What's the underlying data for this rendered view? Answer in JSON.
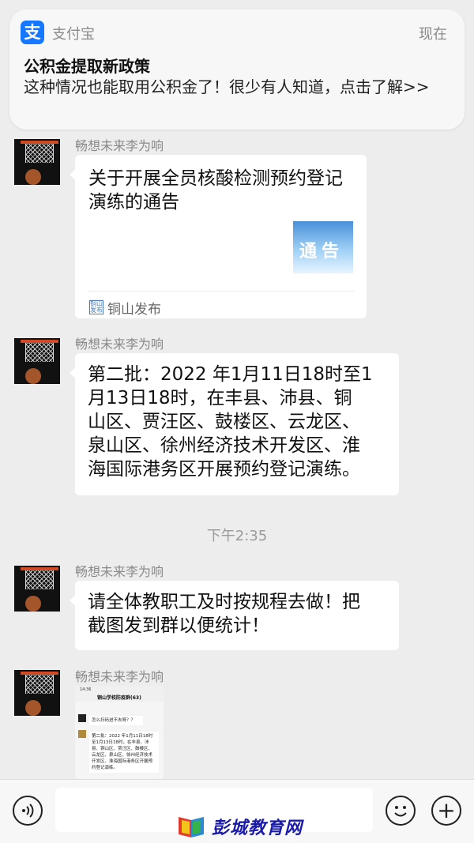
{
  "notification": {
    "app_name": "支付宝",
    "time": "现在",
    "title": "公积金提取新政策",
    "body": "这种情况也能取用公积金了！很少有人知道，点击了解>>",
    "icon": "alipay-icon"
  },
  "messages": [
    {
      "sender": "畅想未来李为响",
      "type": "link",
      "title": "关于开展全员核酸检测预约登记演练的通告",
      "thumb_text": "通告",
      "source": "铜山发布"
    },
    {
      "sender": "畅想未来李为响",
      "type": "text",
      "lines": [
        "第二批：2022 年1月11日18时至1",
        "月13日18时，在丰县、沛县、铜",
        "山区、贾汪区、鼓楼区、云龙区、",
        "泉山区、徐州经济技术开发区、淮",
        "海国际港务区开展预约登记演练。"
      ]
    },
    {
      "sender": "畅想未来李为响",
      "type": "text",
      "lines": [
        "请全体教职工及时按规程去做！把",
        "截图发到群以便统计！"
      ]
    },
    {
      "sender": "畅想未来李为响",
      "type": "image",
      "screenshot": {
        "status_time": "14:36",
        "title": "铜山学校防疫群(63)",
        "msg1": "怎么扫码进不去呀？？",
        "msg2": "第二批：2022 年1月11日18时至1月13日18时，在丰县、沛县、铜山区、贾汪区、鼓楼区、云龙区、泉山区、徐州经济技术开发区、淮海国际港务区开展预约登记演练。"
      }
    }
  ],
  "time_separator": "下午2:35",
  "bottom_bar": {
    "voice_icon": "voice-icon",
    "emoji_icon": "emoji-icon",
    "plus_icon": "plus-icon",
    "input_value": ""
  },
  "watermark": {
    "text": "彭城教育网"
  }
}
